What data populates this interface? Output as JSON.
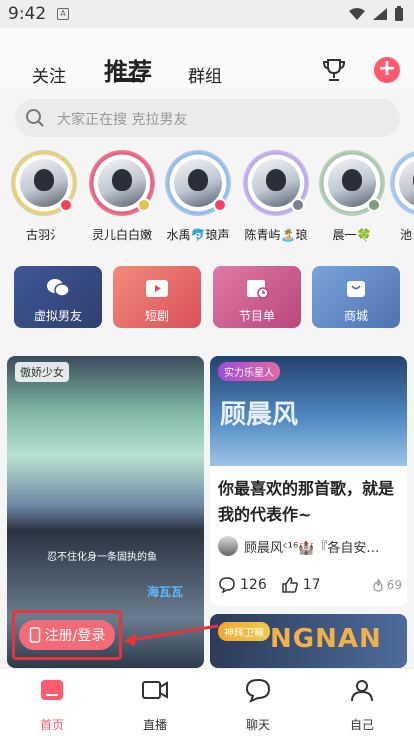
{
  "status_bar": {
    "time": "9:42",
    "sim_label": "A"
  },
  "top_tabs": [
    {
      "label": "关注",
      "active": false
    },
    {
      "label": "推荐",
      "active": true
    },
    {
      "label": "群组",
      "active": false
    }
  ],
  "search": {
    "placeholder": "大家正在搜 克拉男友"
  },
  "avatars": [
    {
      "name": "古羽氵"
    },
    {
      "name": "灵儿白白嫩"
    },
    {
      "name": "水禹🐬琅声"
    },
    {
      "name": "陈青屿🏝️琅"
    },
    {
      "name": "晨一🍀"
    },
    {
      "name": "池"
    }
  ],
  "categories": [
    {
      "label": "虚拟男友",
      "color": "#3c4f86"
    },
    {
      "label": "短剧",
      "color": "#ec6e6e"
    },
    {
      "label": "节目单",
      "color": "#d15f93"
    },
    {
      "label": "商城",
      "color": "#5d86c3"
    }
  ],
  "feed": {
    "left_card": {
      "tag": "傲娇少女",
      "caption": "忍不住化身一条固执的鱼",
      "brand_text": "海瓦瓦"
    },
    "right_card": {
      "label": "实力乐星人",
      "image_title": "顾晨风",
      "title": "你最喜欢的那首歌，就是我的代表作~",
      "author": "顾晨风ᶜ¹⁶🏰『各自安…",
      "comments": "126",
      "likes": "17",
      "hot": "69"
    },
    "right_card2": {
      "label": "神辉卫嘛",
      "image_text": "NGNAN"
    }
  },
  "login_button": {
    "label": "注册/登录"
  },
  "bottom_nav": [
    {
      "label": "首页",
      "active": true
    },
    {
      "label": "直播",
      "active": false
    },
    {
      "label": "聊天",
      "active": false
    },
    {
      "label": "自己",
      "active": false
    }
  ],
  "colors": {
    "accent": "#ff5a6e",
    "highlight_border": "#e8343d"
  }
}
